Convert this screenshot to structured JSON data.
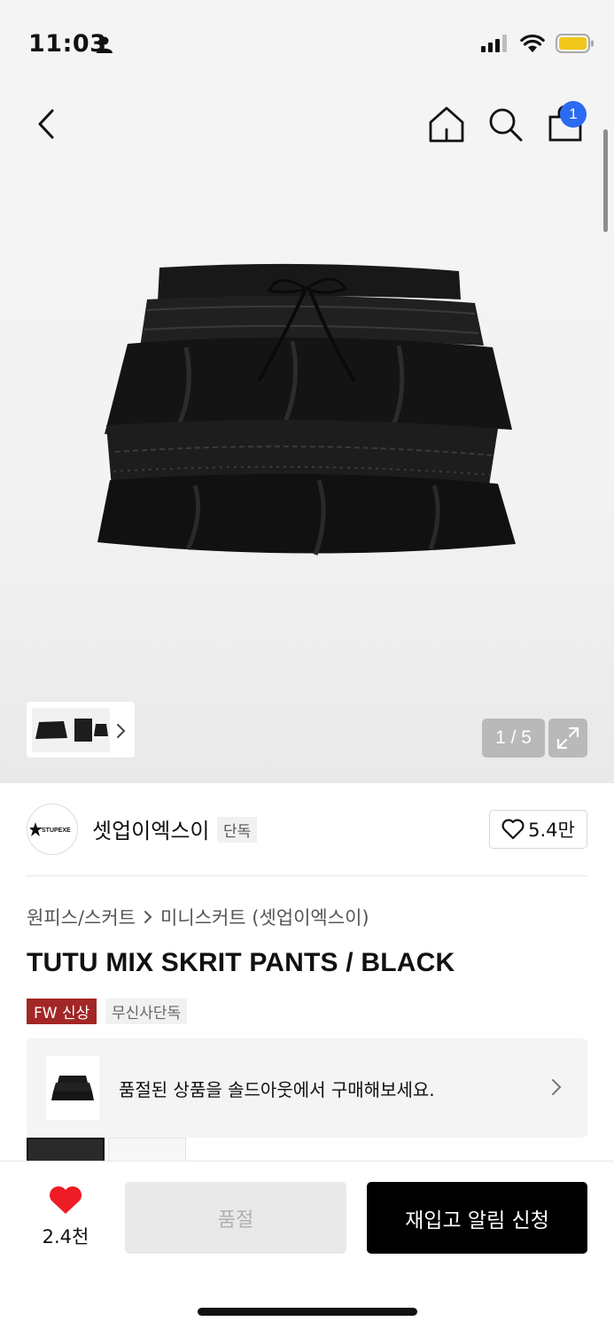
{
  "status_bar": {
    "time": "11:03"
  },
  "header": {
    "cart_count": "1"
  },
  "gallery": {
    "page_counter": "1 / 5"
  },
  "brand": {
    "name": "셋업이엑스이",
    "tag": "단독",
    "likes": "5.4만"
  },
  "breadcrumb": {
    "category": "원피스/스커트",
    "subcategory": "미니스커트 (셋업이엑스이)"
  },
  "product": {
    "title": "TUTU MIX SKRIT PANTS / BLACK",
    "badges": [
      "FW 신상",
      "무신사단독"
    ]
  },
  "soldout_banner": {
    "text": "품절된 상품을 솔드아웃에서 구매해보세요."
  },
  "bottom_bar": {
    "wish_count": "2.4천",
    "soldout_label": "품절",
    "restock_label": "재입고 알림 신청"
  },
  "colors": {
    "accent_badge": "#2a6bf2",
    "new_badge": "#a32626",
    "heart": "#ee1c25"
  }
}
